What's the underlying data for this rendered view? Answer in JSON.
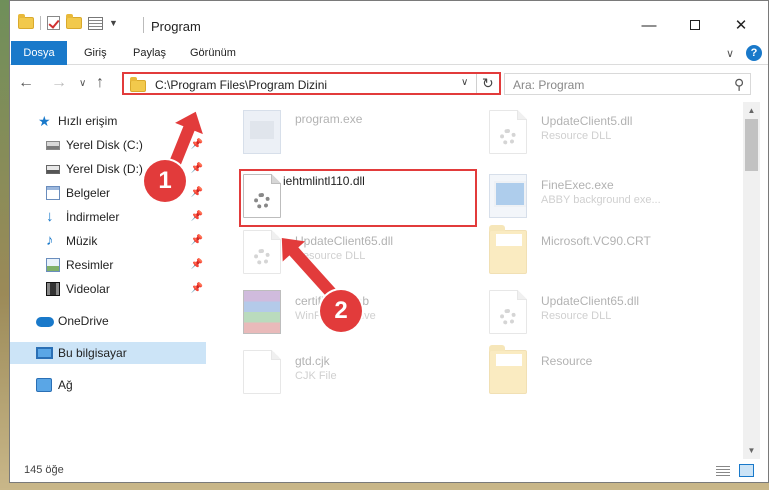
{
  "window": {
    "title": "Program",
    "controls": {
      "minimize": "—",
      "maximize": "",
      "close": "✕"
    }
  },
  "ribbon": {
    "tabs": [
      "Dosya",
      "Giriş",
      "Paylaş",
      "Görünüm"
    ]
  },
  "address_bar": {
    "path": "C:\\Program Files\\Program Dizini"
  },
  "search": {
    "placeholder": "Ara: Program"
  },
  "sidebar": {
    "items": [
      {
        "label": "Hızlı erişim",
        "icon": "star-icon"
      },
      {
        "label": "Yerel Disk (C:)",
        "icon": "disk-icon",
        "pinned": true
      },
      {
        "label": "Yerel Disk (D:)",
        "icon": "disk-icon",
        "pinned": true
      },
      {
        "label": "Belgeler",
        "icon": "documents-icon",
        "pinned": true
      },
      {
        "label": "İndirmeler",
        "icon": "download-icon",
        "pinned": true
      },
      {
        "label": "Müzik",
        "icon": "music-icon",
        "pinned": true
      },
      {
        "label": "Resimler",
        "icon": "pictures-icon",
        "pinned": true
      },
      {
        "label": "Videolar",
        "icon": "video-icon",
        "pinned": true
      },
      {
        "label": "OneDrive",
        "icon": "cloud-icon"
      },
      {
        "label": "Bu bilgisayar",
        "icon": "computer-icon",
        "selected": true
      },
      {
        "label": "Ağ",
        "icon": "network-icon"
      }
    ]
  },
  "files": [
    {
      "name": "program.exe",
      "type": "",
      "icon": "program-icon",
      "faded": true
    },
    {
      "name": "UpdateClient5.dll",
      "type": "Resource DLL",
      "icon": "dll-icon",
      "faded": true
    },
    {
      "name": "iehtmlintl110.dll",
      "type": "",
      "icon": "dll-icon",
      "faded": false,
      "highlighted": true
    },
    {
      "name": "FineExec.exe",
      "type": "ABBY background exe...",
      "icon": "exe-icon",
      "faded": true
    },
    {
      "name": "UpdateClient65.dll",
      "type": "Resource DLL",
      "icon": "dll-icon",
      "faded": true
    },
    {
      "name": "Microsoft.VC90.CRT",
      "type": "",
      "icon": "folder-icon",
      "faded": true
    },
    {
      "name": "certificate.cab",
      "type": "WinRAR archive",
      "icon": "archive-icon",
      "faded": true
    },
    {
      "name": "UpdateClient65.dll",
      "type": "Resource DLL",
      "icon": "dll-icon",
      "faded": true
    },
    {
      "name": "gtd.cjk",
      "type": "CJK File",
      "icon": "file-icon",
      "faded": true
    },
    {
      "name": "Resource",
      "type": "",
      "icon": "folder-icon",
      "faded": true
    }
  ],
  "status": {
    "item_count": "145 öğe"
  },
  "annotations": {
    "step1": "1",
    "step2": "2"
  },
  "colors": {
    "accent": "#1979ca",
    "annotation": "#e23b3b",
    "selected": "#cce4f7"
  }
}
